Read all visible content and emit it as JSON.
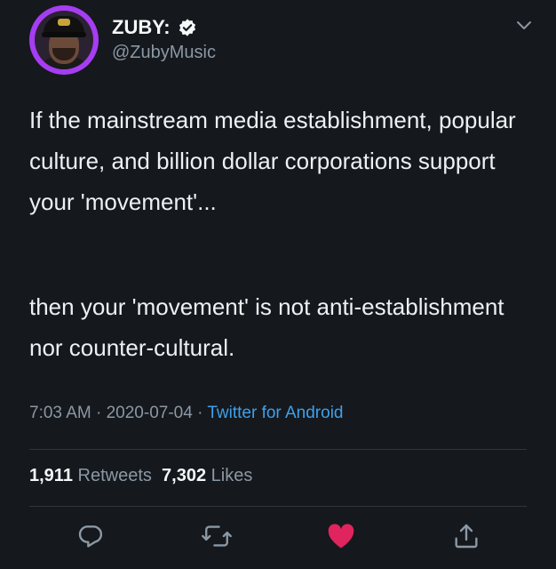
{
  "tweet": {
    "author_name": "ZUBY:",
    "handle": "@ZubyMusic",
    "verified": true,
    "text_paragraphs": [
      "If the mainstream media establishment, popular culture, and billion dollar corporations support your 'movement'...",
      "then your 'movement' is not anti-establishment nor counter-cultural."
    ],
    "time": "7:03 AM",
    "date": "2020-07-04",
    "separator": "·",
    "source": "Twitter for Android",
    "retweets_count": "1,911",
    "retweets_label": "Retweets",
    "likes_count": "7,302",
    "likes_label": "Likes"
  },
  "colors": {
    "background": "#15181c",
    "accent": "#3ea0ec",
    "like": "#e0245e",
    "muted": "#8b98a5",
    "avatar_ring": "#a63df2"
  },
  "icons": [
    "verified-badge-icon",
    "chevron-down-icon",
    "reply-icon",
    "retweet-icon",
    "like-heart-icon",
    "share-icon"
  ]
}
